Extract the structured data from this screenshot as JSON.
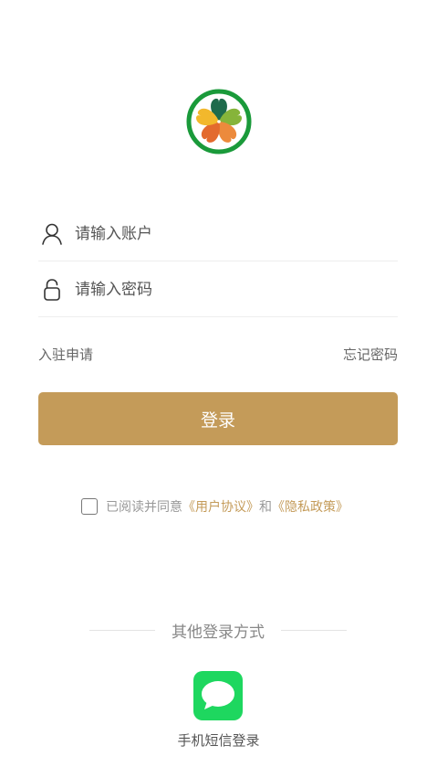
{
  "login_form": {
    "account_placeholder": "请输入账户",
    "password_placeholder": "请输入密码",
    "apply_link": "入驻申请",
    "forgot_link": "忘记密码",
    "login_button": "登录"
  },
  "agreement": {
    "prefix": "已阅读并同意",
    "user_agreement": "《用户协议》",
    "conjunction": "和",
    "privacy_policy": "《隐私政策》",
    "checked": false
  },
  "other_login": {
    "title": "其他登录方式",
    "sms_label": "手机短信登录"
  },
  "icons": {
    "logo": "clover-logo-icon",
    "account": "user-icon",
    "password": "lock-icon",
    "sms": "message-bubble-icon"
  },
  "colors": {
    "accent": "#c49b59",
    "sms_green": "#1ed75f",
    "logo_ring": "#1a9a3a"
  }
}
